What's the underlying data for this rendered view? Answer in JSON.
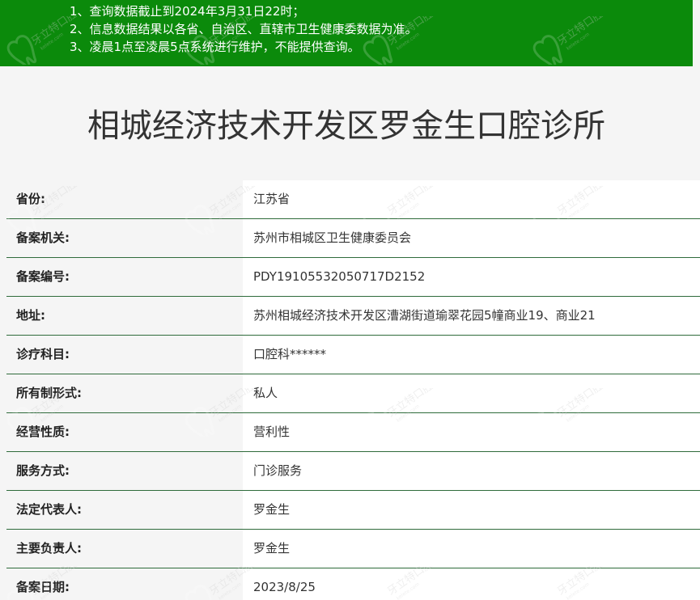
{
  "notice": {
    "items": [
      "1、查询数据截止到2024年3月31日22时；",
      "2、信息数据结果以各省、自治区、直辖市卫生健康委数据为准。",
      "3、凌晨1点至凌晨5点系统进行维护，不能提供查询。"
    ]
  },
  "clinic": {
    "name": "相城经济技术开发区罗金生口腔诊所"
  },
  "info": {
    "rows": [
      {
        "label": "省份:",
        "value": "江苏省"
      },
      {
        "label": "备案机关:",
        "value": "苏州市相城区卫生健康委员会"
      },
      {
        "label": "备案编号:",
        "value": "PDY19105532050717D2152"
      },
      {
        "label": "地址:",
        "value": "苏州相城经济技术开发区漕湖街道瑜翠花园5幢商业19、商业21"
      },
      {
        "label": "诊疗科目:",
        "value": "口腔科******"
      },
      {
        "label": "所有制形式:",
        "value": "私人"
      },
      {
        "label": "经营性质:",
        "value": "营利性"
      },
      {
        "label": "服务方式:",
        "value": "门诊服务"
      },
      {
        "label": "法定代表人:",
        "value": "罗金生"
      },
      {
        "label": "主要负责人:",
        "value": "罗金生"
      },
      {
        "label": "备案日期:",
        "value": "2023/8/25"
      }
    ]
  },
  "watermark": {
    "text": "牙立特口腔",
    "subtext": "kelete.com"
  }
}
